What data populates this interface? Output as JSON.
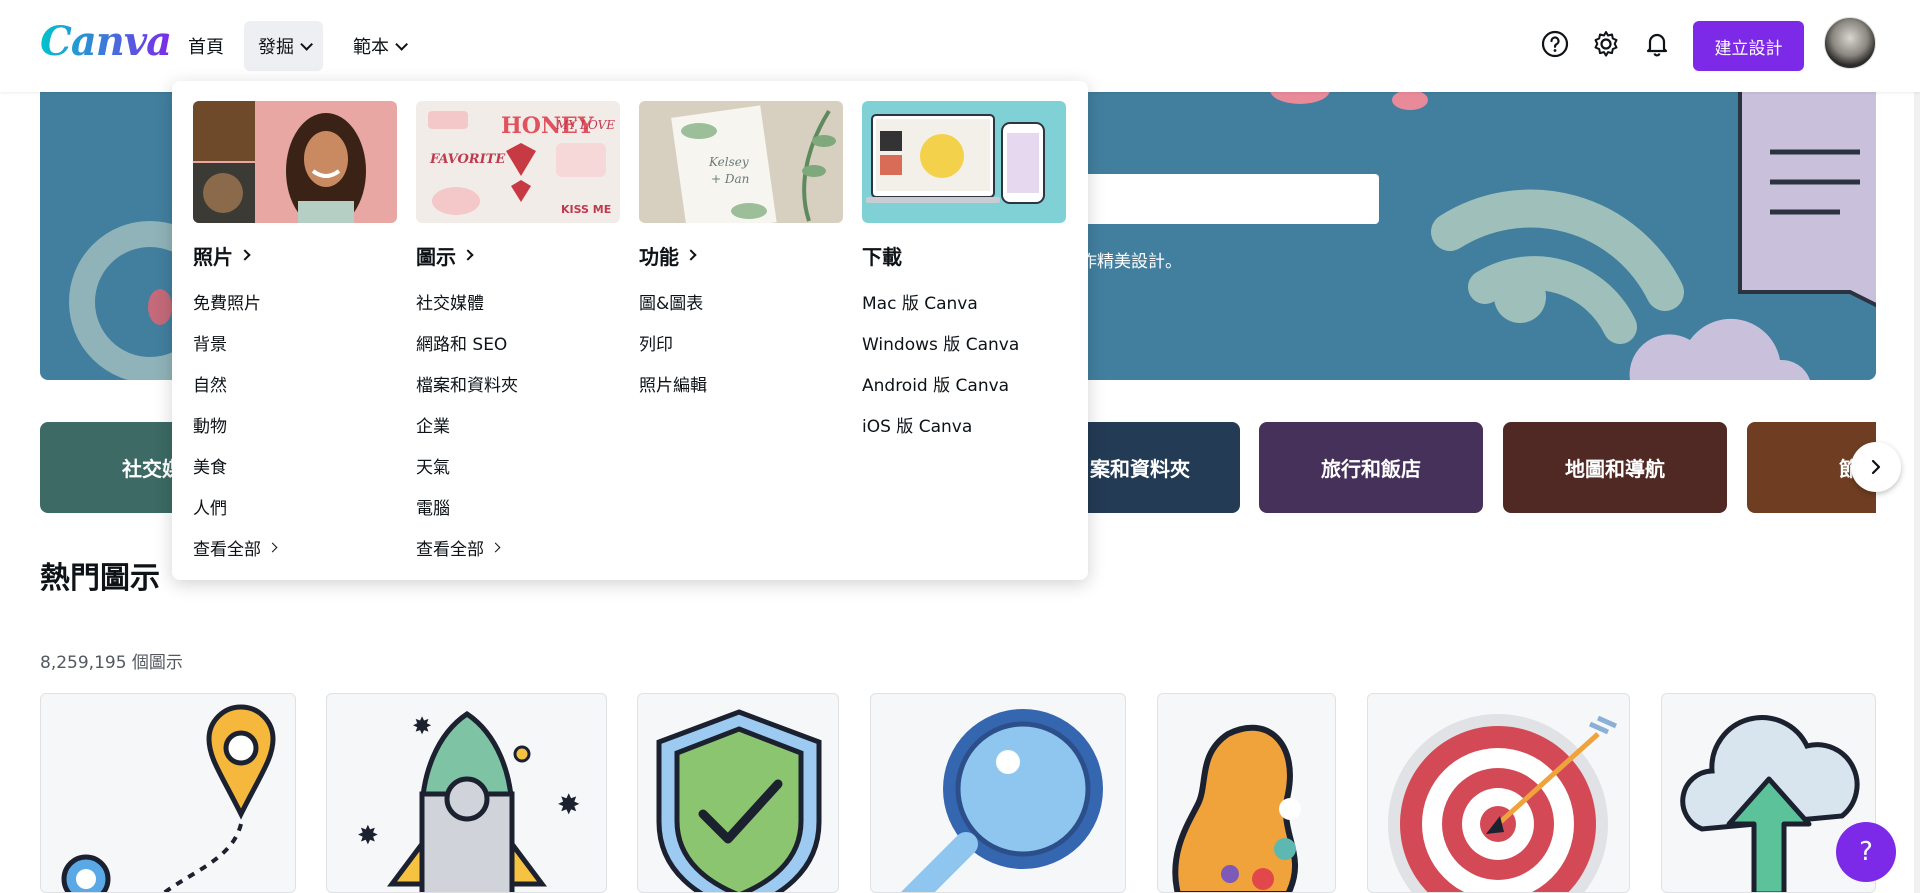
{
  "header": {
    "logo": "Canva",
    "nav": [
      {
        "label": "首頁"
      },
      {
        "label": "發掘"
      },
      {
        "label": "範本"
      }
    ],
    "create_label": "建立設計",
    "icons": [
      "help-icon",
      "gear-icon",
      "bell-icon"
    ]
  },
  "dropdown": {
    "columns": [
      {
        "title": "照片",
        "links": [
          "免費照片",
          "背景",
          "自然",
          "動物",
          "美食",
          "人們"
        ],
        "see_all": "查看全部"
      },
      {
        "title": "圖示",
        "links": [
          "社交媒體",
          "網路和 SEO",
          "檔案和資料夾",
          "企業",
          "天氣",
          "電腦"
        ],
        "see_all": "查看全部"
      },
      {
        "title": "功能",
        "links": [
          "圖&圖表",
          "列印",
          "照片編輯"
        ]
      },
      {
        "title": "下載",
        "links": [
          "Mac 版 Canva",
          "Windows 版 Canva",
          "Android 版 Canva",
          "iOS 版 Canva"
        ]
      }
    ]
  },
  "hero": {
    "subtitle_partial": "作精美設計。"
  },
  "categories": [
    {
      "label": "社交媒",
      "color": "#3d6a64"
    },
    {
      "label": "案和資料夾",
      "color": "#243b55"
    },
    {
      "label": "旅行和飯店",
      "color": "#46315a"
    },
    {
      "label": "地圖和導航",
      "color": "#512924"
    },
    {
      "label": "節",
      "color": "#6f3e22"
    }
  ],
  "section": {
    "title": "熱門圖示",
    "count": "8,259,195 個圖示"
  },
  "colors": {
    "accent": "#7d2ae8",
    "hero_bg": "#427f9f"
  },
  "help_fab": "?"
}
